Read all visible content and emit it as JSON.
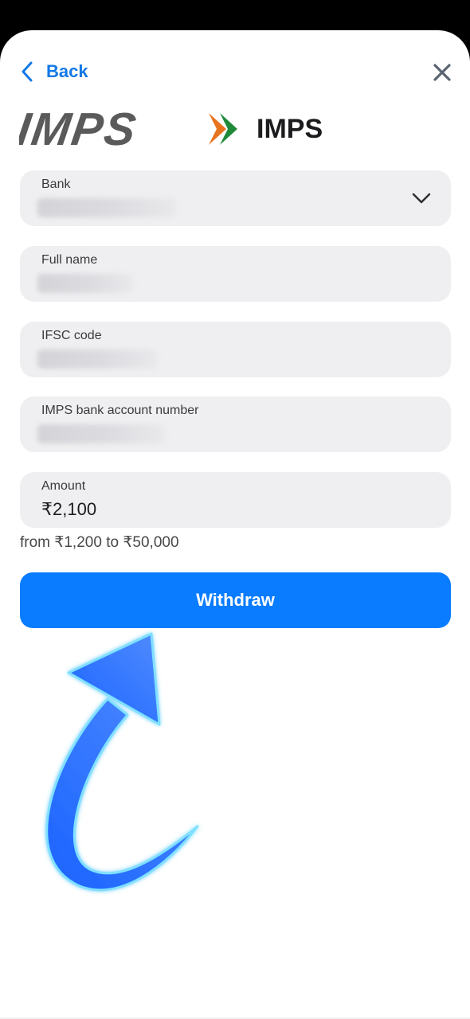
{
  "header": {
    "back_label": "Back",
    "back_icon": "chevron-left-icon",
    "close_icon": "close-icon"
  },
  "brand": {
    "logo_text": "IMPS",
    "title": "IMPS"
  },
  "form": {
    "bank": {
      "label": "Bank",
      "value": "",
      "icon": "chevron-down-icon"
    },
    "full_name": {
      "label": "Full name",
      "value": ""
    },
    "ifsc": {
      "label": "IFSC code",
      "value": ""
    },
    "account": {
      "label": "IMPS bank account number",
      "value": ""
    },
    "amount": {
      "label": "Amount",
      "value": "₹2,100"
    },
    "amount_hint": "from ₹1,200 to ₹50,000"
  },
  "actions": {
    "withdraw_label": "Withdraw"
  },
  "colors": {
    "accent": "#0a7cff",
    "field_bg": "#efeff1",
    "logo_gray": "#5a5a5a",
    "logo_orange": "#e8731f",
    "logo_green": "#1f8a3a"
  }
}
